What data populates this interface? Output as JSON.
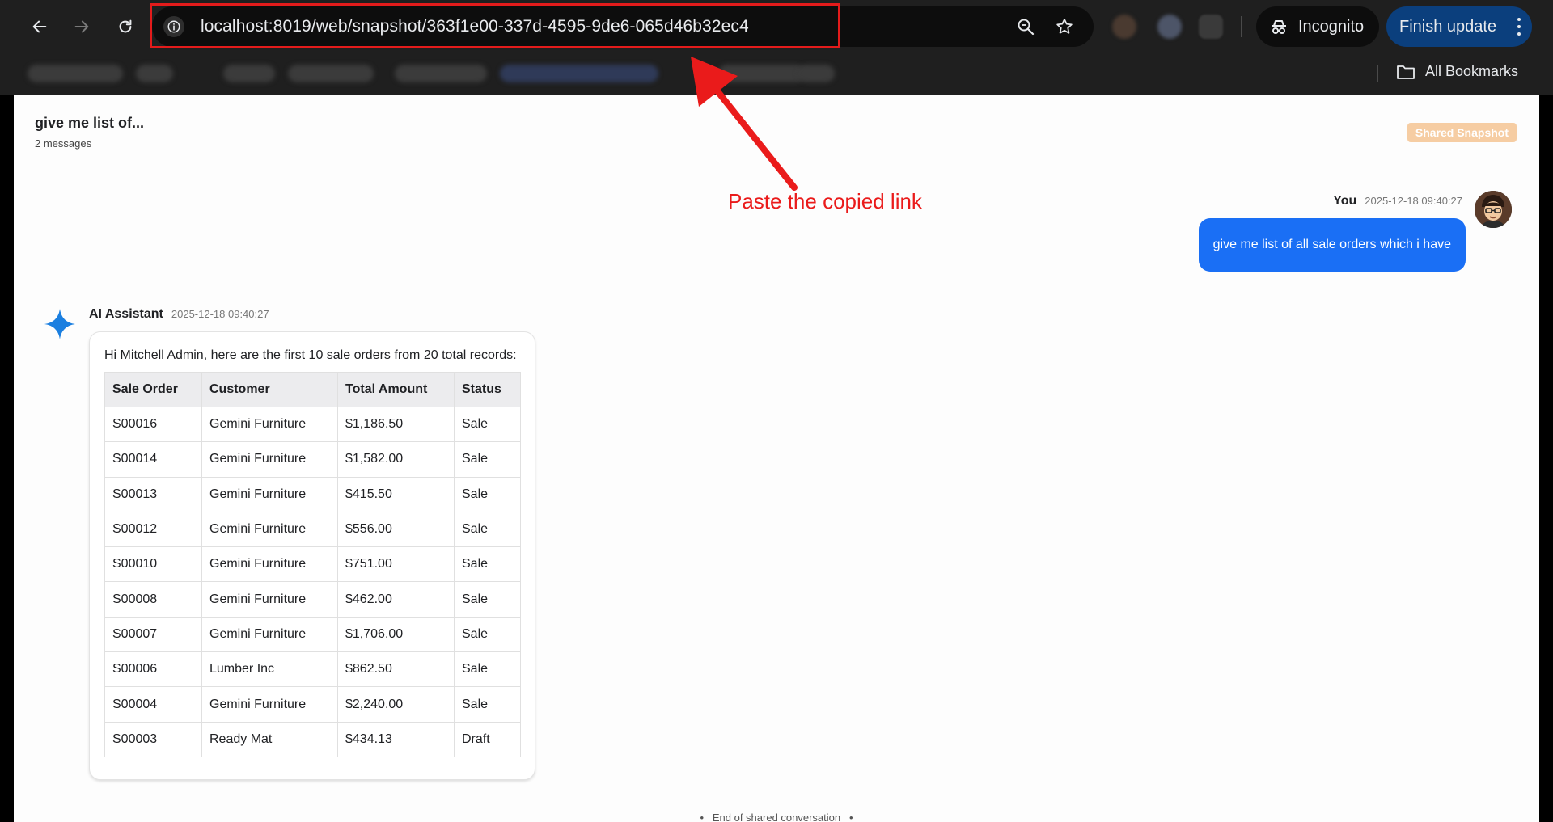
{
  "browser": {
    "url": "localhost:8019/web/snapshot/363f1e00-337d-4595-9de6-065d46b32ec4",
    "incognito_label": "Incognito",
    "finish_update_label": "Finish update",
    "all_bookmarks_label": "All Bookmarks",
    "icons": [
      "back-arrow-icon",
      "forward-arrow-icon",
      "reload-icon",
      "site-info-icon",
      "zoom-icon",
      "bookmark-star-icon",
      "incognito-icon",
      "folder-icon",
      "more-vert-icon"
    ]
  },
  "header": {
    "title": "give me list of...",
    "message_count": "2 messages",
    "badge": "Shared Snapshot"
  },
  "user_message": {
    "sender": "You",
    "timestamp": "2025-12-18 09:40:27",
    "text": "give me list of all sale orders which i have"
  },
  "ai_message": {
    "sender": "AI Assistant",
    "timestamp": "2025-12-18 09:40:27",
    "intro": "Hi Mitchell Admin, here are the first 10 sale orders from 20 total records:",
    "table": {
      "headers": [
        "Sale Order",
        "Customer",
        "Total Amount",
        "Status"
      ],
      "rows": [
        [
          "S00016",
          "Gemini Furniture",
          "$1,186.50",
          "Sale"
        ],
        [
          "S00014",
          "Gemini Furniture",
          "$1,582.00",
          "Sale"
        ],
        [
          "S00013",
          "Gemini Furniture",
          "$415.50",
          "Sale"
        ],
        [
          "S00012",
          "Gemini Furniture",
          "$556.00",
          "Sale"
        ],
        [
          "S00010",
          "Gemini Furniture",
          "$751.00",
          "Sale"
        ],
        [
          "S00008",
          "Gemini Furniture",
          "$462.00",
          "Sale"
        ],
        [
          "S00007",
          "Gemini Furniture",
          "$1,706.00",
          "Sale"
        ],
        [
          "S00006",
          "Lumber Inc",
          "$862.50",
          "Sale"
        ],
        [
          "S00004",
          "Gemini Furniture",
          "$2,240.00",
          "Sale"
        ],
        [
          "S00003",
          "Ready Mat",
          "$434.13",
          "Draft"
        ]
      ]
    }
  },
  "footer": {
    "end_note": "End of shared conversation"
  },
  "annotation": {
    "text": "Paste the copied link",
    "color": "#ea1b1b"
  },
  "colors": {
    "user_bubble": "#1a6ff5",
    "badge": "#f6cda3",
    "ai_star": "#1b7fe0",
    "finish_update_button": "#0b3f7d"
  }
}
